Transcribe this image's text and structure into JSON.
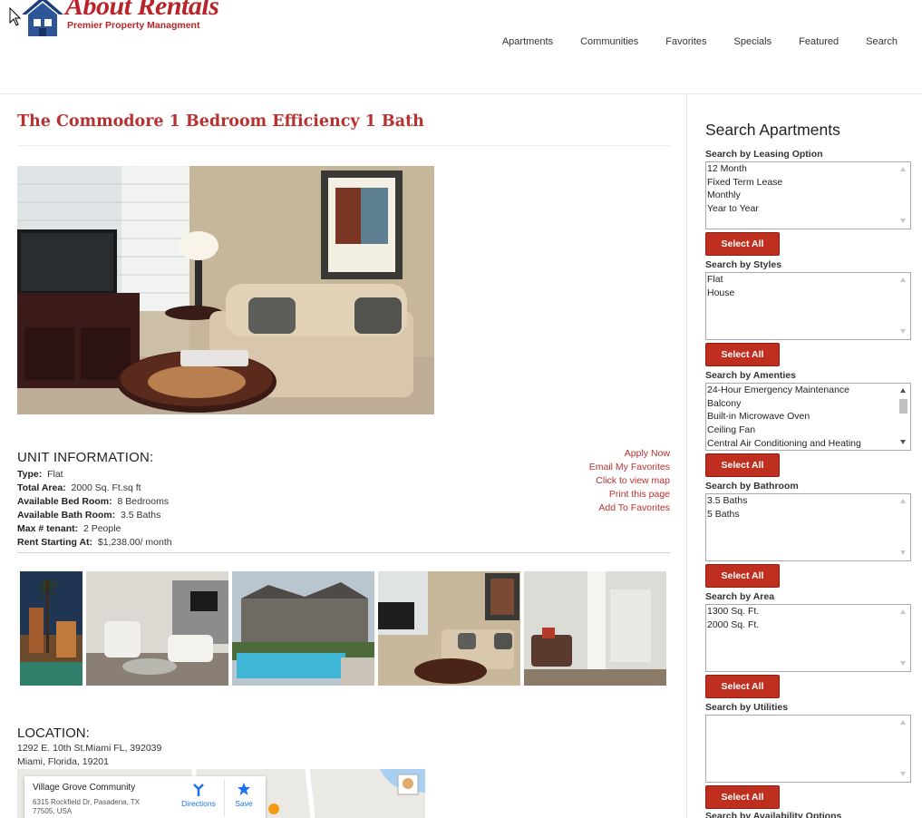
{
  "brand": {
    "name": "About Rentals",
    "tagline": "Premier Property Managment"
  },
  "nav": {
    "items": [
      "Apartments",
      "Communities",
      "Favorites",
      "Specials",
      "Featured",
      "Search"
    ]
  },
  "listing": {
    "title": "The Commodore 1 Bedroom Efficiency 1 Bath",
    "unit_heading": "UNIT INFORMATION:",
    "fields": [
      {
        "label": "Type:",
        "value": "Flat"
      },
      {
        "label": "Total Area:",
        "value": "2000 Sq. Ft.sq ft"
      },
      {
        "label": "Available Bed Room:",
        "value": "8 Bedrooms"
      },
      {
        "label": "Available Bath Room:",
        "value": "3.5 Baths"
      },
      {
        "label": "Max # tenant:",
        "value": "2 People"
      },
      {
        "label": "Rent Starting At:",
        "value": "$1,238.00/ month"
      }
    ],
    "actions": [
      "Apply Now",
      "Email My Favorites",
      "Click to view map",
      "Print this page",
      "Add To Favorites"
    ]
  },
  "location": {
    "heading": "LOCATION:",
    "address_line1": "1292 E. 10th St.Miami FL, 392039",
    "address_line2": "Miami, Florida, 19201",
    "map_card": {
      "name": "Village Grove Community",
      "address": "6315 Rockfield Dr, Pasadena, TX 77505, USA",
      "directions": "Directions",
      "save": "Save"
    }
  },
  "sidebar": {
    "title": "Search Apartments",
    "button_label": "Select All",
    "groups": [
      {
        "label": "Search by Leasing Option",
        "options": [
          "12 Month",
          "Fixed Term Lease",
          "Monthly",
          "Year to Year"
        ]
      },
      {
        "label": "Search by Styles",
        "options": [
          "Flat",
          "House"
        ]
      },
      {
        "label": "Search by Amenties",
        "options": [
          "24-Hour Emergency Maintenance",
          "Balcony",
          "Built-in Microwave Oven",
          "Ceiling Fan",
          "Central Air Conditioning and Heating"
        ]
      },
      {
        "label": "Search by Bathroom",
        "options": [
          "3.5 Baths",
          "5 Baths"
        ]
      },
      {
        "label": "Search by Area",
        "options": [
          "1300 Sq. Ft.",
          "2000 Sq. Ft."
        ]
      },
      {
        "label": "Search by Utilities",
        "options": []
      }
    ],
    "cut_label": "Search by Availability Options"
  }
}
